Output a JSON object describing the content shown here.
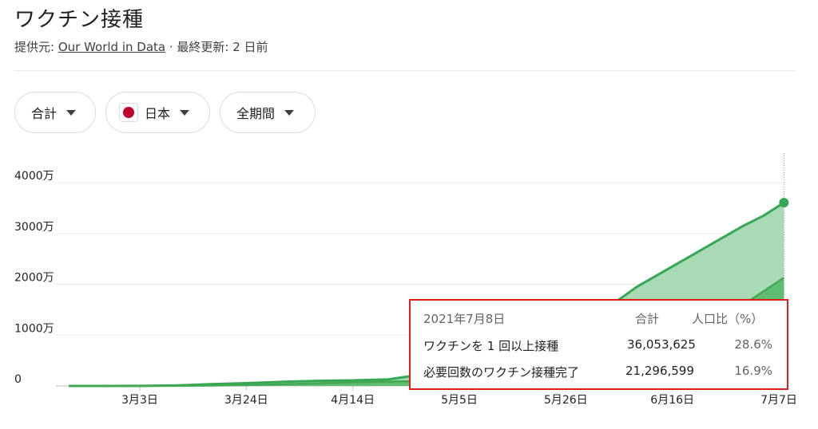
{
  "header": {
    "title": "ワクチン接種",
    "source_prefix": "提供元: ",
    "source_link": "Our World in Data",
    "updated": " · 最終更新: 2 日前"
  },
  "filters": {
    "metric": "合計",
    "country": "日本",
    "period": "全期間"
  },
  "tooltip": {
    "date": "2021年7月8日",
    "col_total": "合計",
    "col_percent": "人口比（%）",
    "rows": [
      {
        "label": "ワクチンを 1 回以上接種",
        "value": "36,053,625",
        "percent": "28.6%"
      },
      {
        "label": "必要回数のワクチン接種完了",
        "value": "21,296,599",
        "percent": "16.9%"
      }
    ]
  },
  "colors": {
    "line": "#34a853",
    "area_light": "#a8dab5",
    "area_dark": "#5fbd72",
    "grid": "#e8eaed",
    "tooltip_border": "#e21b1b"
  },
  "chart_data": {
    "type": "area",
    "x_unit": "days",
    "x_range": [
      "2021-02-17",
      "2021-07-08"
    ],
    "ylim": [
      0,
      40000000
    ],
    "yticks": [
      {
        "value": 0,
        "label": "0"
      },
      {
        "value": 10000000,
        "label": "1000万"
      },
      {
        "value": 20000000,
        "label": "2000万"
      },
      {
        "value": 30000000,
        "label": "3000万"
      },
      {
        "value": 40000000,
        "label": "4000万"
      }
    ],
    "xticks": [
      {
        "date": "2021-03-03",
        "label": "3月3日"
      },
      {
        "date": "2021-03-24",
        "label": "3月24日"
      },
      {
        "date": "2021-04-14",
        "label": "4月14日"
      },
      {
        "date": "2021-05-05",
        "label": "5月5日"
      },
      {
        "date": "2021-05-26",
        "label": "5月26日"
      },
      {
        "date": "2021-06-16",
        "label": "6月16日"
      },
      {
        "date": "2021-07-07",
        "label": "7月7日"
      }
    ],
    "series": [
      {
        "name": "ワクチンを 1 回以上接種",
        "points": [
          [
            "2021-02-17",
            0
          ],
          [
            "2021-03-03",
            10000
          ],
          [
            "2021-03-10",
            100000
          ],
          [
            "2021-03-17",
            350000
          ],
          [
            "2021-03-24",
            550000
          ],
          [
            "2021-03-31",
            800000
          ],
          [
            "2021-04-07",
            1000000
          ],
          [
            "2021-04-14",
            1100000
          ],
          [
            "2021-04-21",
            1300000
          ],
          [
            "2021-04-28",
            2300000
          ],
          [
            "2021-05-05",
            2500000
          ],
          [
            "2021-05-12",
            3500000
          ],
          [
            "2021-05-19",
            6000000
          ],
          [
            "2021-05-26",
            10000000
          ],
          [
            "2021-06-02",
            14500000
          ],
          [
            "2021-06-09",
            19500000
          ],
          [
            "2021-06-16",
            23500000
          ],
          [
            "2021-06-23",
            27500000
          ],
          [
            "2021-06-30",
            31500000
          ],
          [
            "2021-07-04",
            33500000
          ],
          [
            "2021-07-08",
            36053625
          ]
        ]
      },
      {
        "name": "必要回数のワクチン接種完了",
        "points": [
          [
            "2021-02-17",
            0
          ],
          [
            "2021-03-03",
            0
          ],
          [
            "2021-03-10",
            10000
          ],
          [
            "2021-03-24",
            150000
          ],
          [
            "2021-04-14",
            700000
          ],
          [
            "2021-04-28",
            1000000
          ],
          [
            "2021-05-05",
            1200000
          ],
          [
            "2021-05-19",
            1900000
          ],
          [
            "2021-05-26",
            3000000
          ],
          [
            "2021-06-09",
            6800000
          ],
          [
            "2021-06-23",
            12500000
          ],
          [
            "2021-06-30",
            16000000
          ],
          [
            "2021-07-08",
            21296599
          ]
        ]
      }
    ],
    "highlight_date": "2021-07-08",
    "legend": "none"
  }
}
